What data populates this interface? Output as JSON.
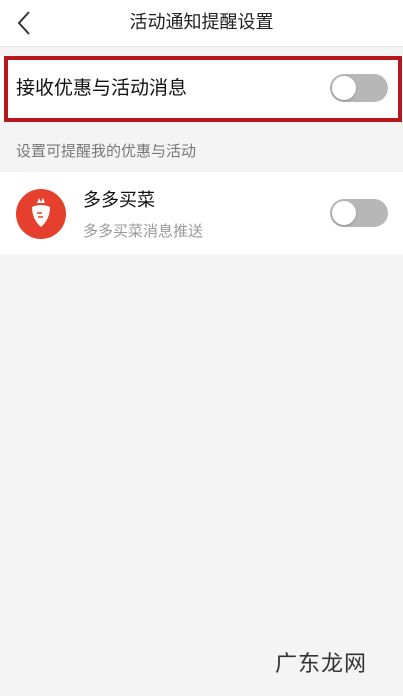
{
  "header": {
    "title": "活动通知提醒设置",
    "back_icon": "chevron-left-icon"
  },
  "activity_toggle": {
    "label": "接收优惠与活动消息",
    "enabled": false
  },
  "section": {
    "header": "设置可提醒我的优惠与活动"
  },
  "apps": [
    {
      "name": "多多买菜",
      "description": "多多买菜消息推送",
      "icon": "carrot-logo-icon",
      "icon_color": "#e5402e",
      "enabled": false
    }
  ],
  "colors": {
    "highlight": "#b5171c",
    "switch_off": "#b7b7b7",
    "background": "#f4f4f4"
  },
  "watermark": "广东龙网"
}
